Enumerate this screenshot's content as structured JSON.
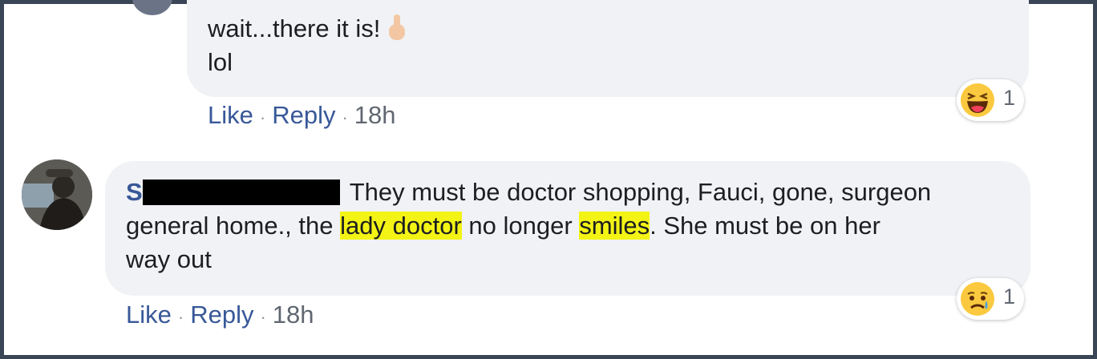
{
  "comments": [
    {
      "lines": [
        "wait...there it is!",
        "lol"
      ],
      "actions": {
        "like": "Like",
        "reply": "Reply",
        "time": "18h"
      },
      "reaction": {
        "icon": "haha-emoji-icon",
        "count": "1"
      }
    },
    {
      "author_initial": "S",
      "text_parts": {
        "a": "They must be doctor shopping, Fauci, gone, surgeon",
        "b": "general home., the ",
        "c": "lady doctor",
        "d": " no longer ",
        "e": "smiles",
        "f": ". She must be on her",
        "g": "way out"
      },
      "actions": {
        "like": "Like",
        "reply": "Reply",
        "time": "18h"
      },
      "reaction": {
        "icon": "sad-emoji-icon",
        "count": "1"
      }
    }
  ],
  "colors": {
    "link": "#385898",
    "bubble": "#f0f2f5",
    "highlight": "#f3f315",
    "frame": "#3a4556"
  }
}
